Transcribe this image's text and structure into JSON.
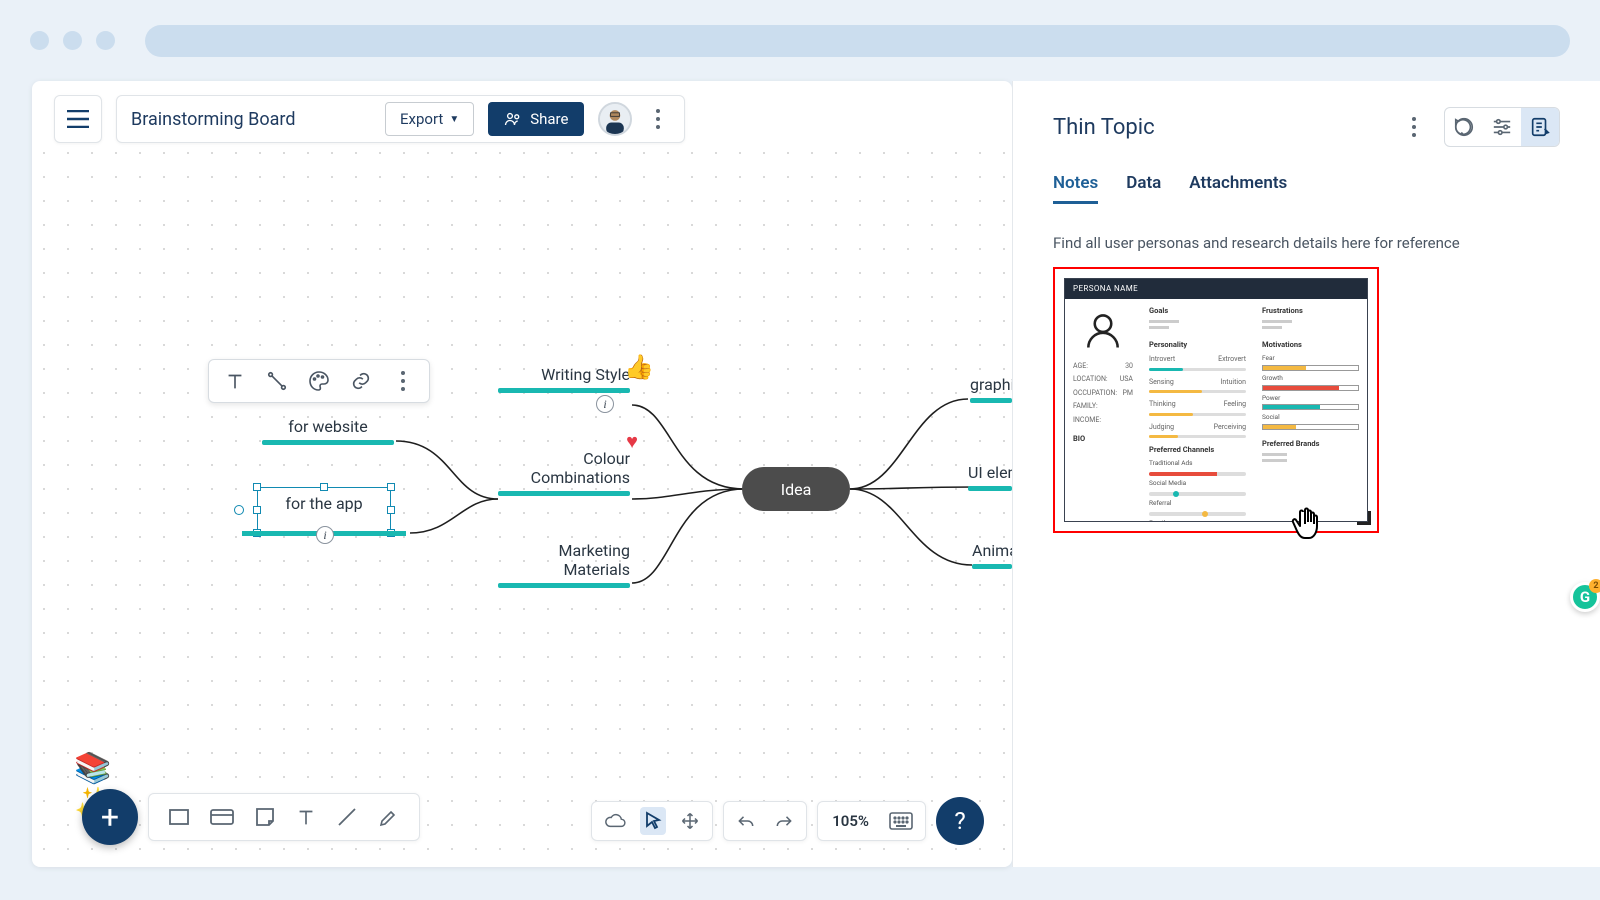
{
  "header": {
    "board_title": "Brainstorming Board",
    "export_label": "Export",
    "share_label": "Share"
  },
  "mindmap": {
    "center": "Idea",
    "left": [
      {
        "label": "Writing Style",
        "has_info": true,
        "emoji": "thumbs-up"
      },
      {
        "label": "Colour Combinations",
        "emoji": "heart"
      },
      {
        "label": "Marketing Materials"
      }
    ],
    "far_left": [
      {
        "label": "for website"
      },
      {
        "label": "for the app",
        "selected": true,
        "has_info": true
      }
    ],
    "right": [
      {
        "label": "graphic style"
      },
      {
        "label": "UI elements"
      },
      {
        "label": "Animations"
      }
    ]
  },
  "context_toolbar": {
    "items": [
      "text",
      "connector",
      "palette",
      "link",
      "more"
    ]
  },
  "bottom_shapes": {
    "items": [
      "rectangle",
      "card",
      "sticky",
      "text",
      "line",
      "highlighter"
    ]
  },
  "view_tools": {
    "cloud": "cloud-sync",
    "cursor": "pointer",
    "pan": "move",
    "undo": "undo",
    "redo": "redo",
    "zoom": "105%",
    "keyboard": "keyboard"
  },
  "side_panel": {
    "title": "Thin Topic",
    "tabs": [
      "Notes",
      "Data",
      "Attachments"
    ],
    "active_tab": "Notes",
    "note_text": "Find all user personas and research details here for reference",
    "persona_card": {
      "header": "PERSONA NAME",
      "demographics": {
        "AGE": "30",
        "LOCATION": "USA",
        "OCCUPATION": "PM",
        "FAMILY": "",
        "INCOME": ""
      },
      "bio_label": "BIO",
      "columns": {
        "goals": "Goals",
        "personality": "Personality",
        "personality_pairs": [
          [
            "Introvert",
            "Extrovert"
          ],
          [
            "Sensing",
            "Intuition"
          ],
          [
            "Thinking",
            "Feeling"
          ],
          [
            "Judging",
            "Perceiving"
          ]
        ],
        "preferred_channels": "Preferred Channels",
        "channels": [
          "Traditional Ads",
          "Social Media",
          "Referral",
          "Email"
        ],
        "frustrations": "Frustrations",
        "motivations": "Motivations",
        "motivation_items": [
          "Fear",
          "Growth",
          "Power",
          "Social"
        ],
        "preferred_brands": "Preferred Brands"
      }
    }
  },
  "colors": {
    "accent": "#123d6a",
    "teal": "#19b8b1",
    "selection": "#118ab2",
    "red": "#ff0000"
  }
}
